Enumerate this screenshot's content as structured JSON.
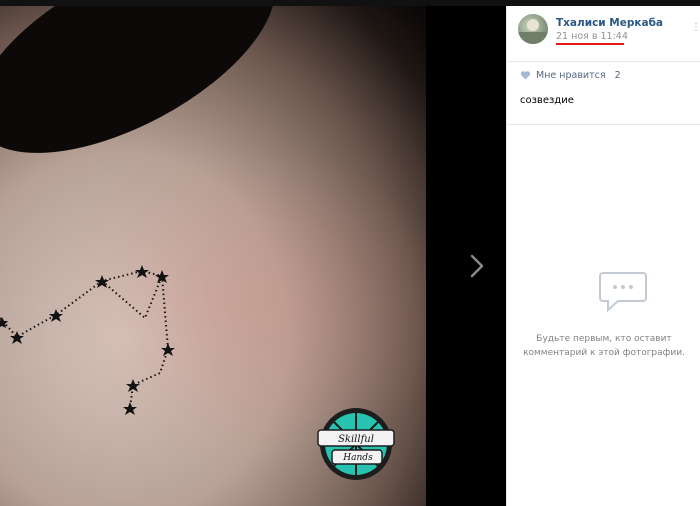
{
  "post": {
    "author": "Тхалиси Меркаба",
    "date": "21 ноя в 11:44",
    "likes_label": "Мне нравится",
    "likes_count": "2",
    "caption": "созвездие"
  },
  "comments": {
    "empty_line1": "Будьте первым, кто оставит",
    "empty_line2": "комментарий к этой фотографии."
  },
  "watermark": {
    "line1": "Skillful",
    "line2": "Hands"
  },
  "colors": {
    "author_link": "#2a5885",
    "date_underline": "#e21a1a",
    "logo_teal": "#27c3b0"
  },
  "icons": {
    "next": "chevron-right-icon",
    "like": "heart-icon",
    "comments": "speech-bubble-icon"
  }
}
